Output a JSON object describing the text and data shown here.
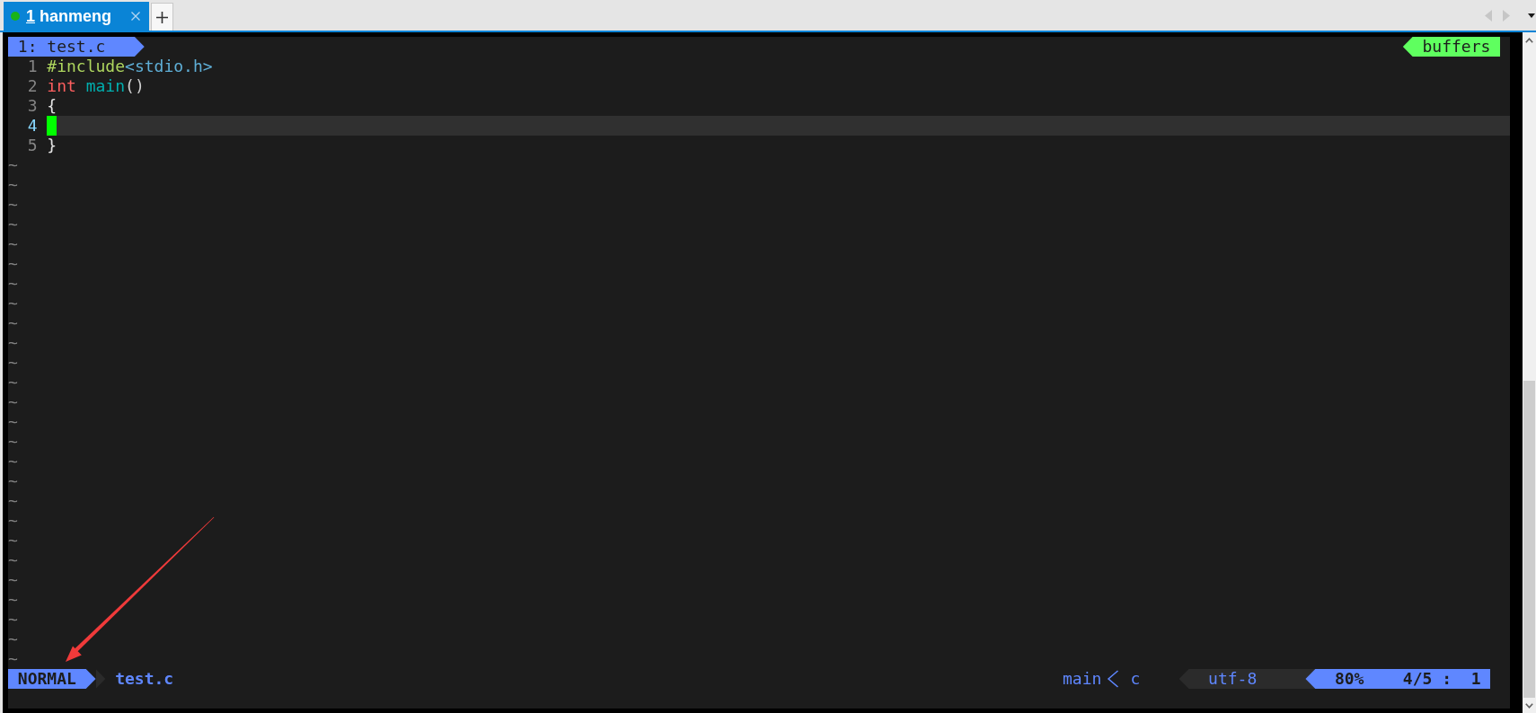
{
  "tabs": [
    {
      "number": "1",
      "title": "hanmeng",
      "selected": true
    }
  ],
  "editor": {
    "buffers": [
      {
        "label": "1: test.c",
        "selected": true
      }
    ],
    "tabline_label": "buffers",
    "lines": [
      {
        "number": "1",
        "current": false,
        "tokens": [
          {
            "kind": "preproc",
            "text": "#include"
          },
          {
            "kind": "header",
            "text": "<stdio.h>"
          }
        ]
      },
      {
        "number": "2",
        "current": false,
        "tokens": [
          {
            "kind": "type",
            "text": "int"
          },
          {
            "kind": "function",
            "text": " main"
          },
          {
            "kind": "paren",
            "text": "()"
          }
        ]
      },
      {
        "number": "3",
        "current": false,
        "tokens": [
          {
            "kind": "brace",
            "text": "{"
          }
        ]
      },
      {
        "number": "4",
        "current": true
      },
      {
        "number": "5",
        "current": false,
        "tokens": [
          {
            "kind": "brace",
            "text": "}"
          }
        ]
      }
    ],
    "empty_line_markers": [
      "~",
      "~",
      "~",
      "~",
      "~",
      "~",
      "~",
      "~",
      "~",
      "~",
      "~",
      "~",
      "~",
      "~",
      "~",
      "~",
      "~",
      "~",
      "~",
      "~",
      "~",
      "~",
      "~",
      "~",
      "~",
      "~"
    ],
    "statusline": {
      "mode": "NORMAL",
      "file": "test.c",
      "function": "main",
      "filetype": "c",
      "encoding": "utf-8",
      "percent": "80%",
      "position": "4/5 :  1"
    }
  }
}
